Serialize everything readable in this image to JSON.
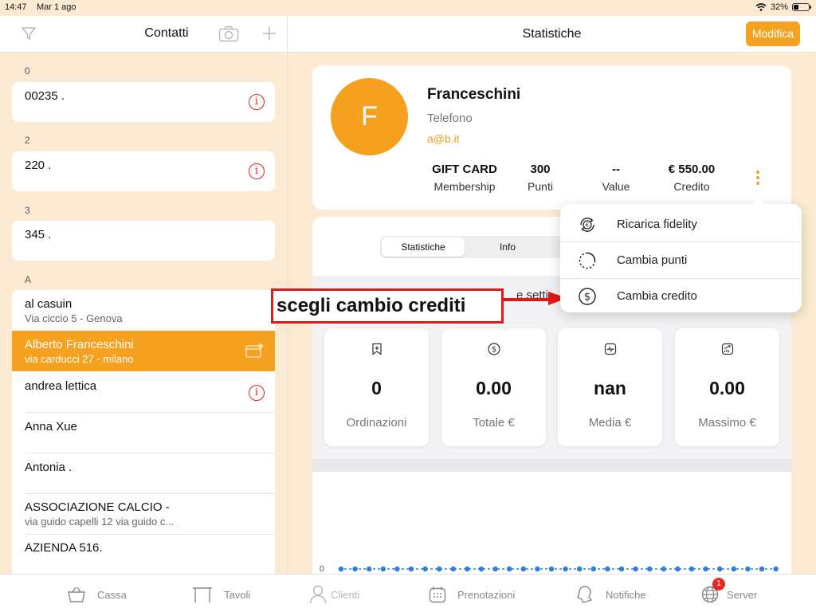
{
  "status_bar": {
    "time": "14:47",
    "date": "Mar 1 ago",
    "battery": "32%"
  },
  "left_header": {
    "title": "Contatti"
  },
  "contacts": [
    {
      "section": "0",
      "name": "00235 .",
      "address": "",
      "info": true
    },
    {
      "section": "2",
      "name": "220 .",
      "address": "",
      "info": true
    },
    {
      "section": "3",
      "name": "345 .",
      "address": "",
      "info": true
    },
    {
      "section": "A",
      "name": "al casuin",
      "address": "Via ciccio 5 - Genova",
      "info": false
    },
    {
      "section": "A",
      "name": "Alberto Franceschini",
      "address": "via carducci  27 - milano",
      "info": false,
      "selected": true
    },
    {
      "section": "A",
      "name": "andrea lettica",
      "address": "",
      "info": true
    },
    {
      "section": "A",
      "name": "Anna Xue",
      "address": "",
      "info": false
    },
    {
      "section": "A",
      "name": "Antonia .",
      "address": "",
      "info": false
    },
    {
      "section": "A",
      "name": "ASSOCIAZIONE CALCIO -",
      "address": "via guido capelli 12 via guido c...",
      "info": false
    },
    {
      "section": "A",
      "name": "AZIENDA 516.",
      "address": "",
      "info": false
    }
  ],
  "right_header": {
    "title": "Statistiche",
    "edit_label": "Modifica"
  },
  "profile": {
    "initial": "F",
    "name": "Franceschini",
    "phone": "Telefono",
    "email": "a@b.it",
    "stats": [
      {
        "value": "GIFT CARD",
        "label": "Membership"
      },
      {
        "value": "300",
        "label": "Punti"
      },
      {
        "value": "--",
        "label": "Value"
      },
      {
        "value": "€ 550.00",
        "label": "Credito"
      }
    ]
  },
  "segments": [
    {
      "label": "Statistiche",
      "active": true
    },
    {
      "label": "Info",
      "active": false
    }
  ],
  "partial_text": "e setti",
  "summary": [
    {
      "value": "0",
      "label": "Ordinazioni",
      "icon": "bookmark-plus-icon"
    },
    {
      "value": "0.00",
      "label": "Totale €",
      "icon": "dollar-circle-icon"
    },
    {
      "value": "nan",
      "label": "Media €",
      "icon": "pulse-chart-icon"
    },
    {
      "value": "0.00",
      "label": "Massimo €",
      "icon": "growth-chart-icon"
    }
  ],
  "chart": {
    "zero_label": "0"
  },
  "menu": [
    {
      "label": "Ricarica fidelity",
      "icon": "euro-refresh-icon"
    },
    {
      "label": "Cambia punti",
      "icon": "dotted-circle-icon"
    },
    {
      "label": "Cambia credito",
      "icon": "dollar-circle-icon"
    }
  ],
  "annotation": {
    "text": "scegli cambio crediti"
  },
  "tabbar": [
    {
      "label": "Cassa",
      "icon": "basket-icon"
    },
    {
      "label": "Tavoli",
      "icon": "table-icon"
    },
    {
      "label": "Clienti",
      "icon": "person-icon",
      "active": true
    },
    {
      "label": "Prenotazioni",
      "icon": "calendar-icon"
    },
    {
      "label": "Notifiche",
      "icon": "bell-icon"
    },
    {
      "label": "Server",
      "icon": "globe-icon",
      "badge": "1"
    }
  ],
  "colors": {
    "accent": "#f5a222",
    "background": "#fcebd2",
    "alert": "#e0241b",
    "annotation": "#e01818"
  }
}
